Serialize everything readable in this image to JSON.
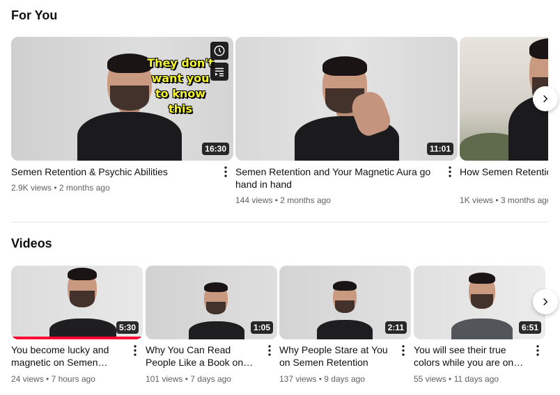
{
  "for_you": {
    "title": "For You",
    "overlay_text": "They don't\nwant you\nto know\nthis",
    "videos": [
      {
        "title": "Semen Retention & Psychic Abilities",
        "views": "2.9K views",
        "age": "2 months ago",
        "duration": "16:30"
      },
      {
        "title": "Semen Retention and Your Magnetic Aura go hand in hand",
        "views": "144 views",
        "age": "2 months ago",
        "duration": "11:01"
      },
      {
        "title": "How Semen Retention Colours",
        "views": "1K views",
        "age": "3 months ago",
        "duration": ""
      }
    ]
  },
  "videos_section": {
    "title": "Videos",
    "videos": [
      {
        "title": "You become lucky and magnetic on Semen Retention",
        "views": "24 views",
        "age": "7 hours ago",
        "duration": "5:30",
        "watched_fraction": 0.99
      },
      {
        "title": "Why You Can Read People Like a Book on Semen Retention",
        "views": "101 views",
        "age": "7 days ago",
        "duration": "1:05"
      },
      {
        "title": "Why People Stare at You on Semen Retention",
        "views": "137 views",
        "age": "9 days ago",
        "duration": "2:11"
      },
      {
        "title": "You will see their true colors while you are on Semen Retention",
        "views": "55 views",
        "age": "11 days ago",
        "duration": "6:51"
      }
    ]
  },
  "meta_separator": "•",
  "icons": {
    "watch_later": "clock-icon",
    "add_to_queue": "queue-icon",
    "more": "kebab-icon",
    "next": "chevron-right-icon"
  },
  "colors": {
    "progress": "#ff0033",
    "overlay_text": "#f5f52c"
  }
}
